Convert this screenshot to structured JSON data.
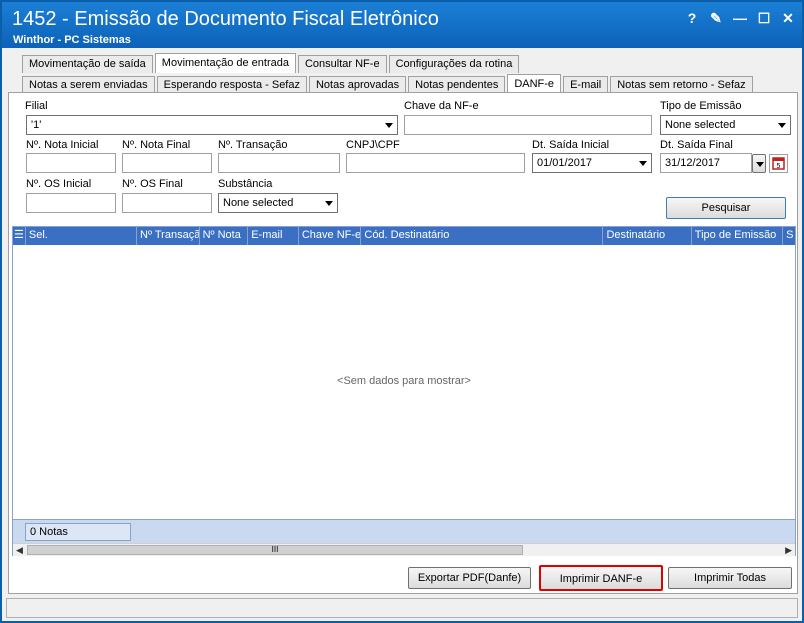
{
  "window": {
    "title": "1452 - Emissão de Documento Fiscal Eletrônico",
    "subtitle": "Winthor - PC Sistemas",
    "controls": [
      "?",
      "✎",
      "—",
      "☐",
      "✕"
    ]
  },
  "tabs_top": [
    {
      "label": "Movimentação de saída",
      "active": false
    },
    {
      "label": "Movimentação de entrada",
      "active": true
    },
    {
      "label": "Consultar NF-e",
      "active": false
    },
    {
      "label": "Configurações da rotina",
      "active": false
    }
  ],
  "tabs_sub": [
    {
      "label": "Notas a serem enviadas",
      "active": false
    },
    {
      "label": "Esperando resposta - Sefaz",
      "active": false
    },
    {
      "label": "Notas aprovadas",
      "active": false
    },
    {
      "label": "Notas pendentes",
      "active": false
    },
    {
      "label": "DANF-e",
      "active": true
    },
    {
      "label": "E-mail",
      "active": false
    },
    {
      "label": "Notas sem retorno - Sefaz",
      "active": false
    }
  ],
  "form": {
    "filial_label": "Filial",
    "filial_value": "'1'",
    "chave_label": "Chave da NF-e",
    "chave_value": "",
    "tipo_emissao_label": "Tipo de Emissão",
    "tipo_emissao_value": "None selected",
    "nota_inicial_label": "Nº. Nota Inicial",
    "nota_final_label": "Nº. Nota Final",
    "transacao_label": "Nº. Transação",
    "cnpj_label": "CNPJ\\CPF",
    "dt_saida_inicial_label": "Dt. Saída Inicial",
    "dt_saida_inicial_value": "01/01/2017",
    "dt_saida_final_label": "Dt. Saída Final",
    "dt_saida_final_value": "31/12/2017",
    "os_inicial_label": "Nº. OS Inicial",
    "os_final_label": "Nº. OS Final",
    "substancia_label": "Substância",
    "substancia_value": "None selected",
    "pesquisar_label": "Pesquisar"
  },
  "grid": {
    "columns": [
      "Sel.",
      "Nº Transação",
      "Nº Nota",
      "E-mail",
      "Chave NF-e",
      "Cód. Destinatário",
      "Destinatário",
      "Tipo de Emissão",
      "S"
    ],
    "empty_text": "<Sem dados para mostrar>",
    "count_text": "0 Notas",
    "scroll_thumb": "III"
  },
  "buttons": {
    "exportar": "Exportar PDF(Danfe)",
    "imprimir": "Imprimir DANF-e",
    "imprimir_todas": "Imprimir Todas"
  },
  "colors": {
    "titlebar": "#0c62b8",
    "grid_header": "#3a6fc4",
    "highlight": "#e00000"
  }
}
